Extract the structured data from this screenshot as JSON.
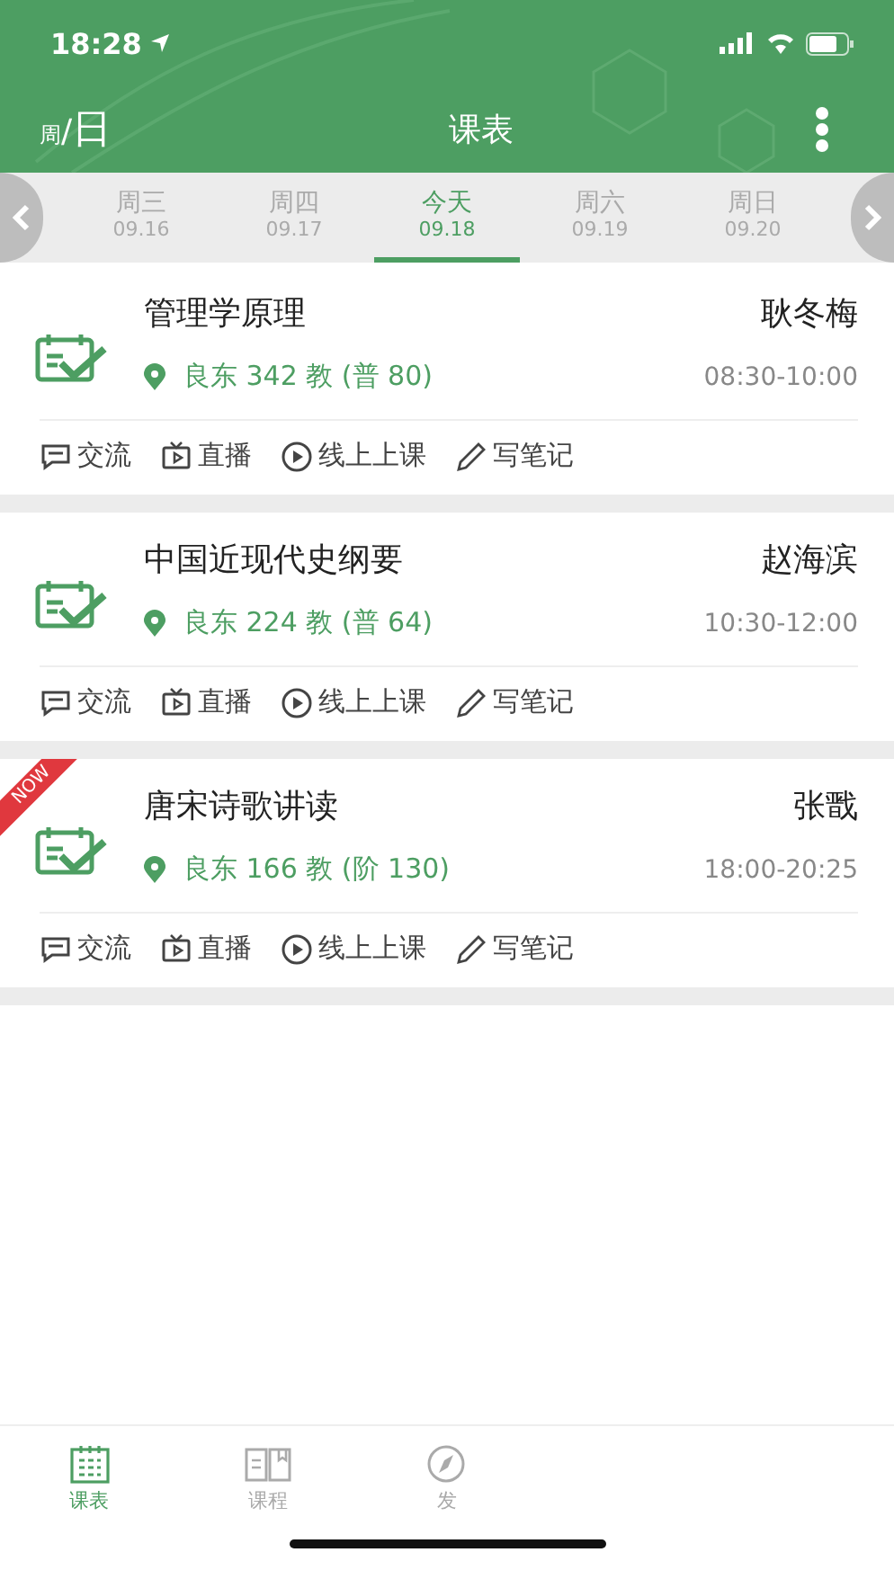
{
  "status_bar": {
    "time": "18:28"
  },
  "header": {
    "mode_small": "周",
    "mode_sep": "/",
    "mode_large": "日",
    "title": "课表"
  },
  "days": [
    {
      "name": "周三",
      "date": "09.16",
      "selected": false
    },
    {
      "name": "周四",
      "date": "09.17",
      "selected": false
    },
    {
      "name": "今天",
      "date": "09.18",
      "selected": true
    },
    {
      "name": "周六",
      "date": "09.19",
      "selected": false
    },
    {
      "name": "周日",
      "date": "09.20",
      "selected": false
    }
  ],
  "courses": [
    {
      "title": "管理学原理",
      "teacher": "耿冬梅",
      "location": "良东 342 教 (普 80)",
      "time": "08:30-10:00",
      "actions": [
        "交流",
        "直播",
        "线上上课",
        "写笔记"
      ]
    },
    {
      "title": "中国近现代史纲要",
      "teacher": "赵海滨",
      "location": "良东 224 教 (普 64)",
      "time": "10:30-12:00",
      "actions": [
        "交流",
        "直播",
        "线上上课",
        "写笔记"
      ]
    },
    {
      "title": "唐宋诗歌讲读",
      "teacher": "张戬",
      "location": "良东 166 教 (阶 130)",
      "time": "18:00-20:25",
      "badge": "NOW",
      "actions": [
        "交流",
        "直播",
        "线上上课",
        "写笔记"
      ]
    }
  ],
  "tab_bar": [
    {
      "kind": "schedule",
      "label": "课表",
      "selected": true
    },
    {
      "kind": "course",
      "label": "课程",
      "selected": false
    },
    {
      "kind": "discover",
      "label": "发",
      "selected": false
    }
  ]
}
